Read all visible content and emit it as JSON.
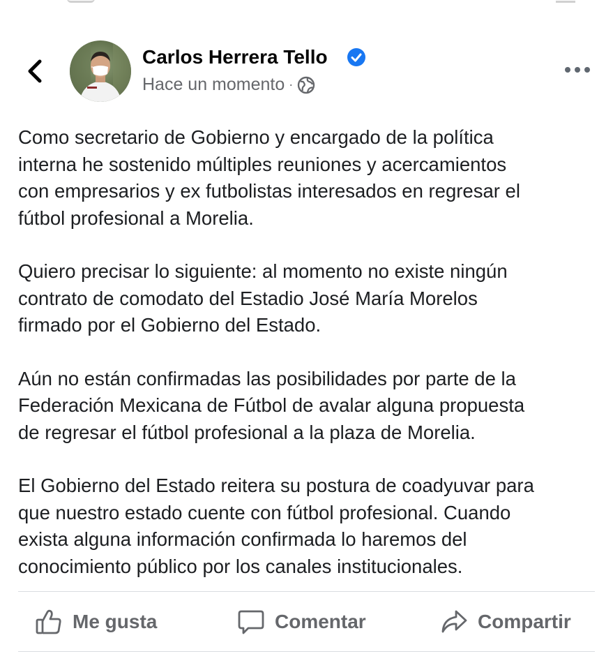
{
  "post": {
    "author": "Carlos Herrera Tello",
    "timestamp": "Hace un momento",
    "separator": "·",
    "audience_icon": "globe-icon",
    "verified_icon": "verified-badge-icon",
    "paragraphs": [
      "Como secretario de Gobierno y encargado de la política\ninterna he sostenido múltiples reuniones y acercamientos\ncon empresarios y ex futbolistas interesados en regresar el\nfútbol profesional a Morelia.",
      "Quiero precisar lo siguiente: al momento no existe ningún\ncontrato de comodato del Estadio José María Morelos\nfirmado por el Gobierno del Estado.",
      "Aún no están confirmadas las posibilidades por parte de la\nFederación Mexicana de Fútbol  de avalar alguna propuesta\nde regresar el fútbol profesional a la plaza de Morelia.",
      "El Gobierno del Estado reitera su postura de coadyuvar para\nque nuestro estado cuente con fútbol profesional. Cuando\nexista alguna información confirmada lo haremos del\nconocimiento público por los canales institucionales."
    ]
  },
  "actions": {
    "like": "Me gusta",
    "comment": "Comentar",
    "share": "Compartir"
  },
  "colors": {
    "verified": "#1877f2",
    "secondary_text": "#65676b",
    "primary_text": "#1c1e21"
  }
}
